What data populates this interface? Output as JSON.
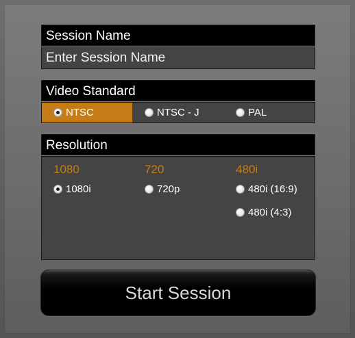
{
  "session": {
    "header": "Session Name",
    "placeholder": "Enter Session Name",
    "value": ""
  },
  "video_standard": {
    "header": "Video Standard",
    "options": [
      {
        "label": "NTSC",
        "selected": true
      },
      {
        "label": "NTSC - J",
        "selected": false
      },
      {
        "label": "PAL",
        "selected": false
      }
    ]
  },
  "resolution": {
    "header": "Resolution",
    "groups": [
      {
        "label": "1080",
        "options": [
          {
            "label": "1080i",
            "selected": true
          }
        ]
      },
      {
        "label": "720",
        "options": [
          {
            "label": "720p",
            "selected": false
          }
        ]
      },
      {
        "label": "480i",
        "options": [
          {
            "label": "480i (16:9)",
            "selected": false
          },
          {
            "label": "480i (4:3)",
            "selected": false
          }
        ]
      }
    ]
  },
  "start_button": {
    "label": "Start Session"
  },
  "colors": {
    "accent": "#c67c16",
    "header_bg": "#000000",
    "panel_bg": "#444444"
  }
}
